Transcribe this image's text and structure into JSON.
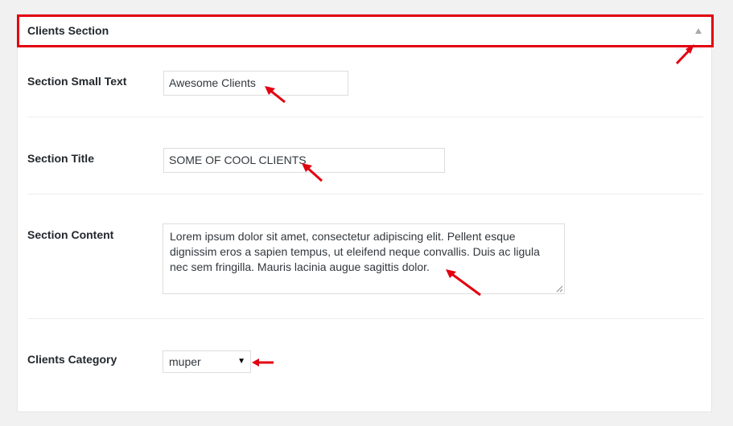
{
  "section": {
    "title": "Clients Section",
    "toggle_icon": "triangle-up-icon",
    "accent_color": "#e3000f"
  },
  "fields": {
    "small_text": {
      "label": "Section Small Text",
      "value": "Awesome Clients"
    },
    "title": {
      "label": "Section Title",
      "value": "SOME OF COOL CLIENTS"
    },
    "content": {
      "label": "Section Content",
      "value": "Lorem ipsum dolor sit amet, consectetur adipiscing elit. Pellent esque dignissim eros a sapien tempus, ut eleifend neque convallis. Duis ac ligula nec sem fringilla. Mauris lacinia augue sagittis dolor."
    },
    "category": {
      "label": "Clients Category",
      "selected": "muper",
      "arrow_icon": "caret-down-icon"
    }
  },
  "annotations": {
    "icon": "red-arrow-icon",
    "color": "#e3000f"
  }
}
